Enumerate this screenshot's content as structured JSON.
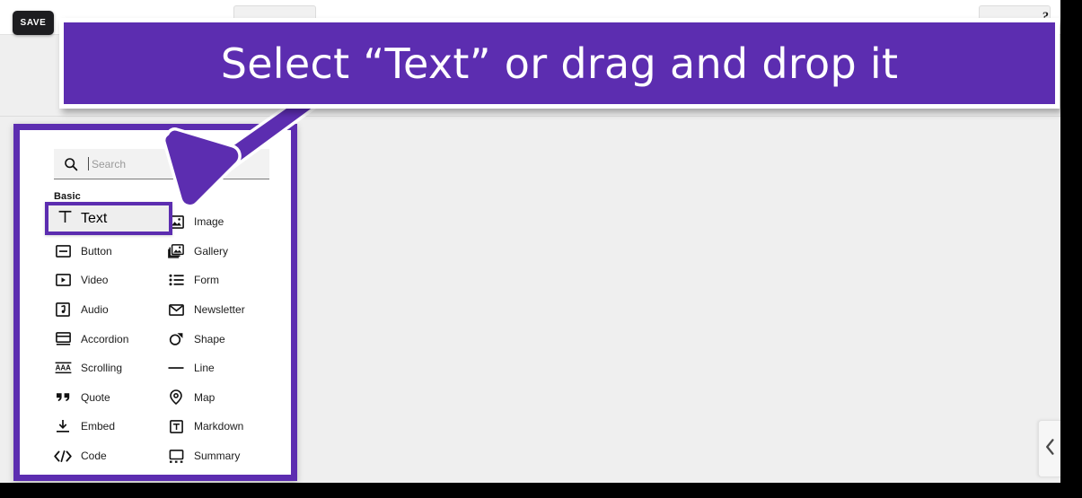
{
  "app": {
    "background_color": "#efefef",
    "accent_color": "#5c2db0",
    "frame_color": "#000000"
  },
  "toolbar": {
    "save_label": "SAVE",
    "help_label": "?"
  },
  "callout": {
    "banner_text": "Select “Text” or drag and drop it",
    "banner_color": "#5c2db0",
    "banner_text_color": "#ffffff",
    "arrow_name": "arrow-pointing-to-text-item"
  },
  "panel": {
    "search": {
      "placeholder": "Search",
      "value": "",
      "icon": "search-icon"
    },
    "group_label": "Basic",
    "selected_item": "Text",
    "items": [
      {
        "label": "Text",
        "icon": "text-icon",
        "column": "left",
        "selected": true
      },
      {
        "label": "Image",
        "icon": "image-icon",
        "column": "right",
        "selected": false
      },
      {
        "label": "Button",
        "icon": "button-icon",
        "column": "left",
        "selected": false
      },
      {
        "label": "Gallery",
        "icon": "gallery-icon",
        "column": "right",
        "selected": false
      },
      {
        "label": "Video",
        "icon": "video-icon",
        "column": "left",
        "selected": false
      },
      {
        "label": "Form",
        "icon": "form-icon",
        "column": "right",
        "selected": false
      },
      {
        "label": "Audio",
        "icon": "audio-icon",
        "column": "left",
        "selected": false
      },
      {
        "label": "Newsletter",
        "icon": "newsletter-icon",
        "column": "right",
        "selected": false
      },
      {
        "label": "Accordion",
        "icon": "accordion-icon",
        "column": "left",
        "selected": false
      },
      {
        "label": "Shape",
        "icon": "shape-icon",
        "column": "right",
        "selected": false
      },
      {
        "label": "Scrolling",
        "icon": "scrolling-icon",
        "column": "left",
        "selected": false
      },
      {
        "label": "Line",
        "icon": "line-icon",
        "column": "right",
        "selected": false
      },
      {
        "label": "Quote",
        "icon": "quote-icon",
        "column": "left",
        "selected": false
      },
      {
        "label": "Map",
        "icon": "map-icon",
        "column": "right",
        "selected": false
      },
      {
        "label": "Embed",
        "icon": "embed-icon",
        "column": "left",
        "selected": false
      },
      {
        "label": "Markdown",
        "icon": "markdown-icon",
        "column": "right",
        "selected": false
      },
      {
        "label": "Code",
        "icon": "code-icon",
        "column": "left",
        "selected": false
      },
      {
        "label": "Summary",
        "icon": "summary-icon",
        "column": "right",
        "selected": false
      }
    ]
  },
  "sidebar_handle": {
    "icon": "chevron-left-icon"
  }
}
